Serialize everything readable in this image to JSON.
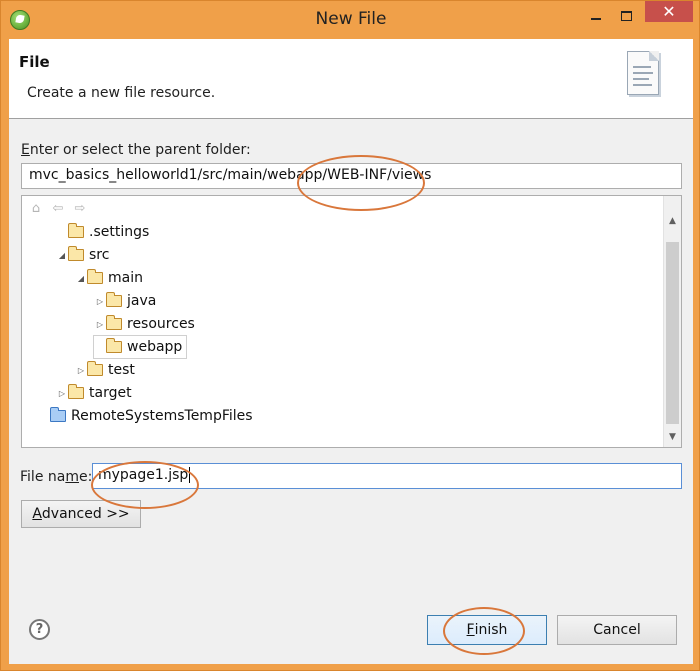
{
  "window": {
    "title": "New File"
  },
  "banner": {
    "title": "File",
    "description": "Create a new file resource."
  },
  "parent_folder": {
    "label": "Enter or select the parent folder:",
    "value": "mvc_basics_helloworld1/src/main/webapp/WEB-INF/views"
  },
  "tree": {
    "nodes": [
      {
        "label": ".settings",
        "expander": ""
      },
      {
        "label": "src",
        "expander": "expanded"
      },
      {
        "label": "main",
        "expander": "expanded"
      },
      {
        "label": "java",
        "expander": "collapsed"
      },
      {
        "label": "resources",
        "expander": "collapsed"
      },
      {
        "label": "webapp",
        "expander": "",
        "selected": true
      },
      {
        "label": "test",
        "expander": "collapsed"
      },
      {
        "label": "target",
        "expander": "collapsed"
      },
      {
        "label": "RemoteSystemsTempFiles",
        "expander": ""
      }
    ]
  },
  "file_name": {
    "label_prefix": "File na",
    "label_mnemonic": "m",
    "label_suffix": "e:",
    "value": "mypage1.jsp"
  },
  "buttons": {
    "advanced_mnemonic": "A",
    "advanced_rest": "dvanced >>",
    "finish_mnemonic": "F",
    "finish_rest": "inish",
    "cancel": "Cancel",
    "help": "?"
  },
  "icons": {
    "app": "spring-tool-suite-icon",
    "banner": "new-file-wizard-icon",
    "home": "home-icon",
    "back": "back-arrow-icon",
    "forward": "forward-arrow-icon"
  },
  "colors": {
    "title_bar": "#f0a049",
    "annotation": "#d9773b",
    "close_button": "#c7504b"
  }
}
